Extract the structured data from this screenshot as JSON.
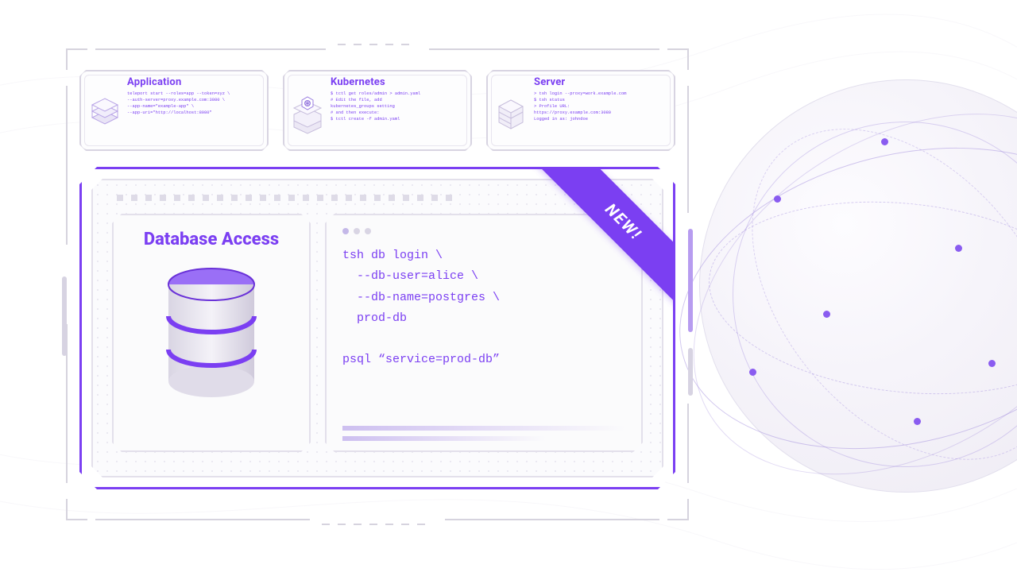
{
  "cards": [
    {
      "title": "Application",
      "body": "teleport start --roles=app --token=xyz \\\n--auth-server=proxy.example.com:3080 \\\n--app-name=\"example-app\" \\\n--app-uri=\"http://localhost:8080\""
    },
    {
      "title": "Kubernetes",
      "body": "$ tctl get roles/admin > admin.yaml\n# Edit the file, add\nkubernetes_groups setting\n# and then execute:\n$ tctl create -f admin.yaml"
    },
    {
      "title": "Server",
      "body": "> tsh login --proxy=work.example.com\n$ tsh status\n> Profile URL:\nhttps://proxy.example.com:3080\nLogged in as: johndoe"
    }
  ],
  "main": {
    "ribbon": "NEW!",
    "db_title": "Database Access",
    "terminal_lines": "tsh db login \\\n  --db-user=alice \\\n  --db-name=postgres \\\n  prod-db\n\npsql “service=prod-db”"
  },
  "colors": {
    "accent": "#7b3ff2",
    "frame": "#d6d3de"
  }
}
